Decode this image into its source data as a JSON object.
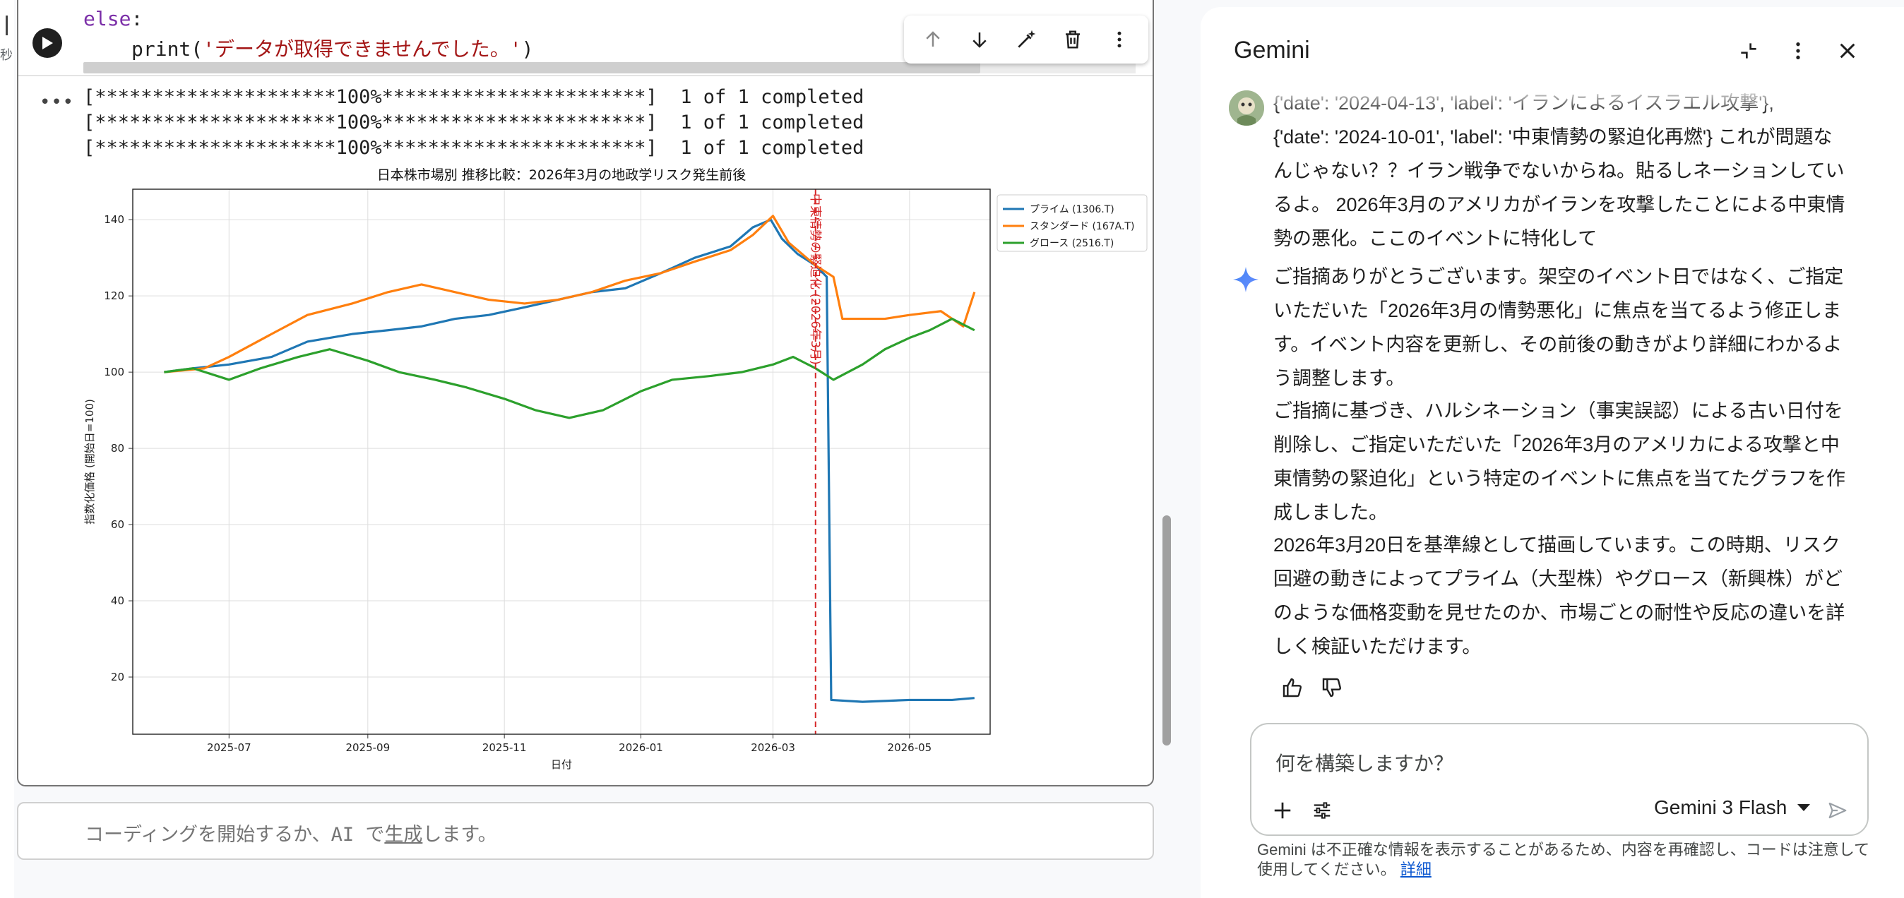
{
  "notebook": {
    "exec_time_label": "秒",
    "code": {
      "line1_kw": "else",
      "line1_punc": ":",
      "line2_fn": "print(",
      "line2_str": "'データが取得できませんでした。'",
      "line2_close": ")"
    },
    "toolbar_icons": [
      "arrow-up-icon",
      "arrow-down-icon",
      "edit-icon",
      "delete-icon",
      "more-vert-icon"
    ],
    "output": {
      "more_label": "•••",
      "progress_lines": [
        "[*********************100%***********************]  1 of 1 completed",
        "[*********************100%***********************]  1 of 1 completed",
        "[*********************100%***********************]  1 of 1 completed"
      ]
    },
    "next_cell": {
      "placeholder_before": "コーディングを開始するか、AI で",
      "placeholder_link": "生成",
      "placeholder_after": "します。"
    }
  },
  "chart_data": {
    "type": "line",
    "title": "日本株市場別 推移比較：2026年3月の地政学リスク発生前後",
    "xlabel": "日付",
    "ylabel": "指数化価格 (開始日=100)",
    "x_ticks": [
      "2025-07",
      "2025-09",
      "2025-11",
      "2026-01",
      "2026-03",
      "2026-05"
    ],
    "y_ticks": [
      20,
      40,
      60,
      80,
      100,
      120,
      140
    ],
    "ylim": [
      5,
      148
    ],
    "xlim": [
      "2025-05-19",
      "2026-06-06"
    ],
    "grid": true,
    "legend_position": "upper-right-outside",
    "event": {
      "date": "2026-03-20",
      "label": "中東情勢の緊迫化 (2026年3月)",
      "color": "#d62728"
    },
    "series": [
      {
        "name": "プライム (1306.T)",
        "color": "#1f77b4",
        "points": [
          [
            "2025-06-02",
            100
          ],
          [
            "2025-06-15",
            101
          ],
          [
            "2025-07-01",
            102
          ],
          [
            "2025-07-20",
            104
          ],
          [
            "2025-08-05",
            108
          ],
          [
            "2025-08-25",
            110
          ],
          [
            "2025-09-10",
            111
          ],
          [
            "2025-09-25",
            112
          ],
          [
            "2025-10-10",
            114
          ],
          [
            "2025-10-25",
            115
          ],
          [
            "2025-11-10",
            117
          ],
          [
            "2025-11-25",
            119
          ],
          [
            "2025-12-10",
            121
          ],
          [
            "2025-12-25",
            122
          ],
          [
            "2026-01-10",
            126
          ],
          [
            "2026-01-25",
            130
          ],
          [
            "2026-02-10",
            133
          ],
          [
            "2026-02-20",
            138
          ],
          [
            "2026-02-28",
            140
          ],
          [
            "2026-03-05",
            135
          ],
          [
            "2026-03-12",
            131
          ],
          [
            "2026-03-20",
            128
          ],
          [
            "2026-03-25",
            125
          ],
          [
            "2026-03-27",
            14
          ],
          [
            "2026-04-10",
            13.5
          ],
          [
            "2026-05-01",
            14
          ],
          [
            "2026-05-20",
            14
          ],
          [
            "2026-05-30",
            14.5
          ]
        ]
      },
      {
        "name": "スタンダード (167A.T)",
        "color": "#ff7f0e",
        "points": [
          [
            "2025-06-02",
            100
          ],
          [
            "2025-06-20",
            101
          ],
          [
            "2025-07-01",
            104
          ],
          [
            "2025-07-20",
            110
          ],
          [
            "2025-08-05",
            115
          ],
          [
            "2025-08-25",
            118
          ],
          [
            "2025-09-10",
            121
          ],
          [
            "2025-09-25",
            123
          ],
          [
            "2025-10-10",
            121
          ],
          [
            "2025-10-25",
            119
          ],
          [
            "2025-11-10",
            118
          ],
          [
            "2025-11-25",
            119
          ],
          [
            "2025-12-10",
            121
          ],
          [
            "2025-12-25",
            124
          ],
          [
            "2026-01-10",
            126
          ],
          [
            "2026-01-25",
            129
          ],
          [
            "2026-02-10",
            132
          ],
          [
            "2026-02-20",
            136
          ],
          [
            "2026-03-01",
            141
          ],
          [
            "2026-03-08",
            134
          ],
          [
            "2026-03-20",
            128
          ],
          [
            "2026-03-28",
            125
          ],
          [
            "2026-04-01",
            114
          ],
          [
            "2026-04-20",
            114
          ],
          [
            "2026-05-01",
            115
          ],
          [
            "2026-05-15",
            116
          ],
          [
            "2026-05-25",
            112
          ],
          [
            "2026-05-30",
            121
          ]
        ]
      },
      {
        "name": "グロース (2516.T)",
        "color": "#2ca02c",
        "points": [
          [
            "2025-06-02",
            100
          ],
          [
            "2025-06-15",
            101
          ],
          [
            "2025-07-01",
            98
          ],
          [
            "2025-07-15",
            101
          ],
          [
            "2025-08-01",
            104
          ],
          [
            "2025-08-15",
            106
          ],
          [
            "2025-09-01",
            103
          ],
          [
            "2025-09-15",
            100
          ],
          [
            "2025-10-01",
            98
          ],
          [
            "2025-10-15",
            96
          ],
          [
            "2025-11-01",
            93
          ],
          [
            "2025-11-15",
            90
          ],
          [
            "2025-11-30",
            88
          ],
          [
            "2025-12-15",
            90
          ],
          [
            "2026-01-01",
            95
          ],
          [
            "2026-01-15",
            98
          ],
          [
            "2026-02-01",
            99
          ],
          [
            "2026-02-15",
            100
          ],
          [
            "2026-03-01",
            102
          ],
          [
            "2026-03-10",
            104
          ],
          [
            "2026-03-20",
            101
          ],
          [
            "2026-03-28",
            98
          ],
          [
            "2026-04-10",
            102
          ],
          [
            "2026-04-20",
            106
          ],
          [
            "2026-05-01",
            109
          ],
          [
            "2026-05-10",
            111
          ],
          [
            "2026-05-20",
            114
          ],
          [
            "2026-05-30",
            111
          ]
        ]
      }
    ]
  },
  "gemini": {
    "title": "Gemini",
    "header_icons": [
      "collapse-icon",
      "more-vert-icon",
      "close-icon"
    ],
    "user_message": "{'date': '2024-04-13', 'label': 'イランによるイスラエル攻撃'}, {'date': '2024-10-01', 'label': '中東情勢の緊迫化再燃'} これが問題なんじゃない？？イラン戦争でないからね。貼るしネーションしているよ。 2026年3月のアメリカがイランを攻撃したことによる中東情勢の悪化。ここのイベントに特化して",
    "user_lines": [
      "{'date': '2024-04-13', 'label': 'イランによるイスラエル攻撃'},",
      "{'date': '2024-10-01', 'label': '中東情勢の緊迫化再燃'} これが問題な",
      "んじゃない？？イラン戦争でないからね。貼るしネーションしてい",
      "るよ。 2026年3月のアメリカがイランを攻撃したことによる中東情",
      "勢の悪化。ここのイベントに特化して"
    ],
    "reply_p1_lines": [
      "ご指摘ありがとうございます。架空のイベント日ではなく、ご指定",
      "いただいた「2026年3月の情勢悪化」に焦点を当てるよう修正しま",
      "す。イベント内容を更新し、その前後の動きがより詳細にわかるよ",
      "う調整します。"
    ],
    "reply_p2_lines": [
      "ご指摘に基づき、ハルシネーション（事実誤認）による古い日付を",
      "削除し、ご指定いただいた「2026年3月のアメリカによる攻撃と中",
      "東情勢の緊迫化」という特定のイベントに焦点を当てたグラフを作",
      "成しました。"
    ],
    "reply_p3_lines": [
      "2026年3月20日を基準線として描画しています。この時期、リスク",
      "回避の動きによってプライム（大型株）やグロース（新興株）がど",
      "のような価格変動を見せたのか、市場ごとの耐性や反応の違いを詳",
      "しく検証いただけます。"
    ],
    "input_placeholder": "何を構築しますか？",
    "model_label": "Gemini 3 Flash",
    "disclaimer_text": "Gemini は不正確な情報を表示することがあるため、内容を再確認し、コードは注意して使用してください。",
    "disclaimer_link": "詳細"
  }
}
